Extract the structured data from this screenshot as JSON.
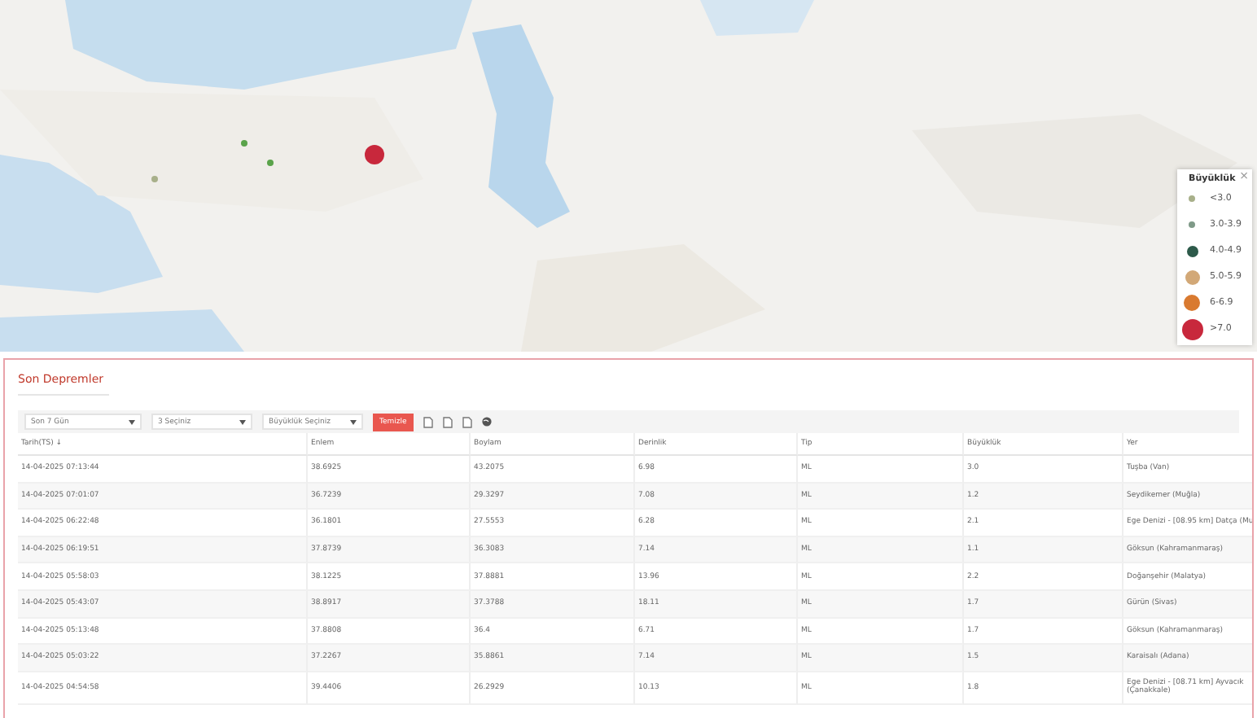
{
  "legend": {
    "title": "Büyüklük",
    "close": "×",
    "items": [
      {
        "label": "<3.0",
        "color": "#a8b08a"
      },
      {
        "label": "3.0-3.9",
        "color": "#7f9a88"
      },
      {
        "label": "4.0-4.9",
        "color": "#2d5a4a"
      },
      {
        "label": "5.0-5.9",
        "color": "#d2a877"
      },
      {
        "label": "6-6.9",
        "color": "#d97a30"
      },
      {
        "label": ">7.0",
        "color": "#c8283c"
      }
    ]
  },
  "panel": {
    "title": "Son Depremler"
  },
  "filters": [
    {
      "value": "Son 7 Gün"
    },
    {
      "value": "3 Seçiniz"
    },
    {
      "value": "Büyüklük Seçiniz"
    }
  ],
  "clear_button": "Temizle",
  "columns": [
    "Tarih(TS) ↓",
    "Enlem",
    "Boylam",
    "Derinlik",
    "Tip",
    "Büyüklük",
    "Yer"
  ],
  "rows": [
    [
      "14-04-2025 07:13:44",
      "38.6925",
      "43.2075",
      "6.98",
      "ML",
      "3.0",
      "Tuşba (Van)"
    ],
    [
      "14-04-2025 07:01:07",
      "36.7239",
      "29.3297",
      "7.08",
      "ML",
      "1.2",
      "Seydikemer (Muğla)"
    ],
    [
      "14-04-2025 06:22:48",
      "36.1801",
      "27.5553",
      "6.28",
      "ML",
      "2.1",
      "Ege Denizi - [08.95 km] Datça (Mu"
    ],
    [
      "14-04-2025 06:19:51",
      "37.8739",
      "36.3083",
      "7.14",
      "ML",
      "1.1",
      "Göksun (Kahramanmaraş)"
    ],
    [
      "14-04-2025 05:58:03",
      "38.1225",
      "37.8881",
      "13.96",
      "ML",
      "2.2",
      "Doğanşehir (Malatya)"
    ],
    [
      "14-04-2025 05:43:07",
      "38.8917",
      "37.3788",
      "18.11",
      "ML",
      "1.7",
      "Gürün (Sivas)"
    ],
    [
      "14-04-2025 05:13:48",
      "37.8808",
      "36.4",
      "6.71",
      "ML",
      "1.7",
      "Göksun (Kahramanmaraş)"
    ],
    [
      "14-04-2025 05:03:22",
      "37.2267",
      "35.8861",
      "7.14",
      "ML",
      "1.5",
      "Karaisalı (Adana)"
    ],
    [
      "14-04-2025 04:54:58",
      "39.4406",
      "26.2929",
      "10.13",
      "ML",
      "1.8",
      "Ege Denizi - [08.71 km] Ayvacık (Çanakkale)"
    ]
  ]
}
